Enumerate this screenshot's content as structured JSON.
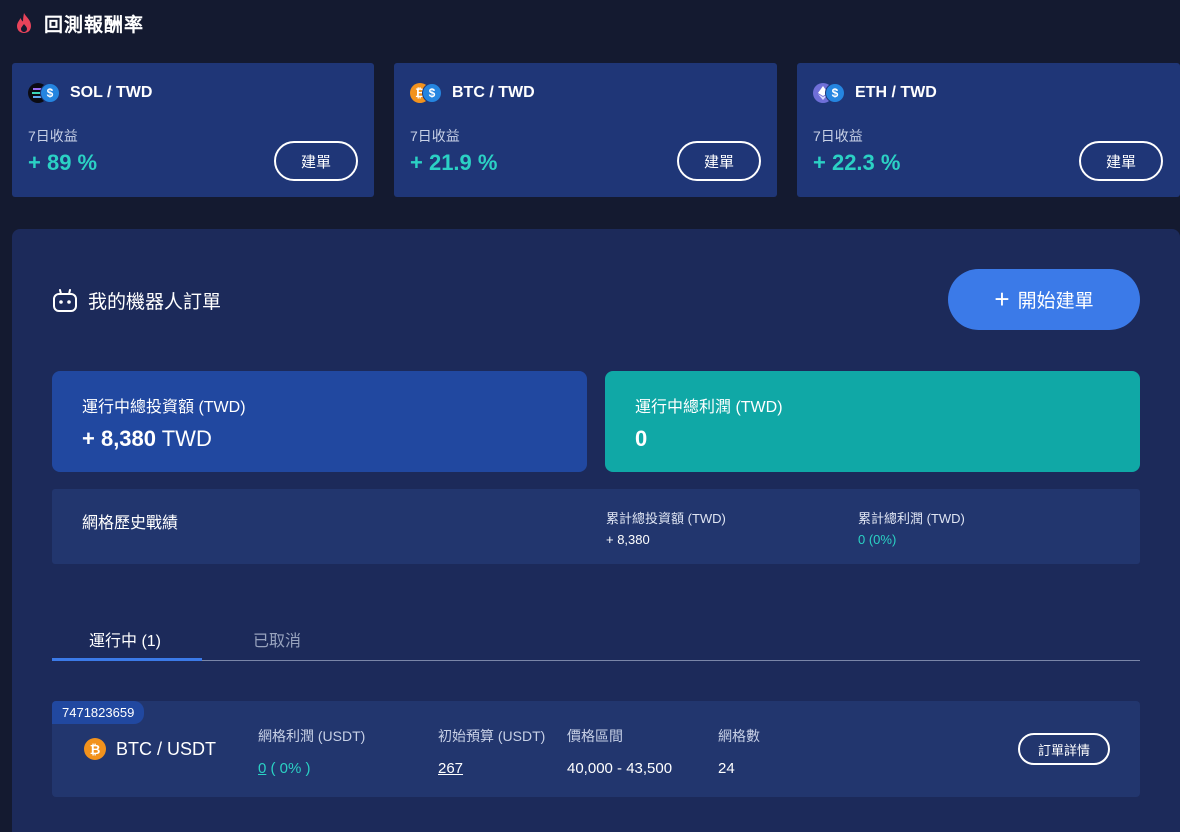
{
  "header": {
    "title": "回測報酬率",
    "icon": "fire-icon",
    "icon_color": "#e8435a"
  },
  "pairs": [
    {
      "name": "SOL / TWD",
      "return_label": "7日收益",
      "return_value": "+ 89 %",
      "button": "建單",
      "coin_icon": "solana-icon",
      "quote_icon": "dollar-icon"
    },
    {
      "name": "BTC / TWD",
      "return_label": "7日收益",
      "return_value": "+ 21.9 %",
      "button": "建單",
      "coin_icon": "bitcoin-icon",
      "quote_icon": "dollar-icon"
    },
    {
      "name": "ETH / TWD",
      "return_label": "7日收益",
      "return_value": "+ 22.3 %",
      "button": "建單",
      "coin_icon": "ethereum-icon",
      "quote_icon": "dollar-icon"
    }
  ],
  "bots": {
    "title": "我的機器人訂單",
    "icon": "robot-icon",
    "start_button": "開始建單",
    "running_invest": {
      "label": "運行中總投資額 (TWD)",
      "value": "+ 8,380",
      "unit": "TWD"
    },
    "running_profit": {
      "label": "運行中總利潤 (TWD)",
      "value": "0"
    },
    "history": {
      "title": "網格歷史戰績",
      "total_invest_label": "累計總投資額 (TWD)",
      "total_invest_value": "+ 8,380",
      "total_profit_label": "累計總利潤 (TWD)",
      "total_profit_value": "0 (0%)"
    },
    "tabs": [
      {
        "label": "運行中 (1)",
        "active": true
      },
      {
        "label": "已取消",
        "active": false
      }
    ],
    "orders": [
      {
        "id": "7471823659",
        "pair": "BTC / USDT",
        "grid_profit_label": "網格利潤 (USDT)",
        "grid_profit_value": "0",
        "grid_profit_pct": " ( 0% )",
        "budget_label": "初始預算 (USDT)",
        "budget_value": "267",
        "range_label": "價格區間",
        "range_value": "40,000 - 43,500",
        "grids_label": "網格數",
        "grids_value": "24",
        "detail_button": "訂單詳情"
      }
    ]
  },
  "colors": {
    "background": "#141a30",
    "card": "#1f3677",
    "panel": "#1c2a5a",
    "accent_blue": "#3b7ae8",
    "teal": "#2bd1c4",
    "profit_box": "#10a8a6",
    "bitcoin": "#f2921d"
  }
}
